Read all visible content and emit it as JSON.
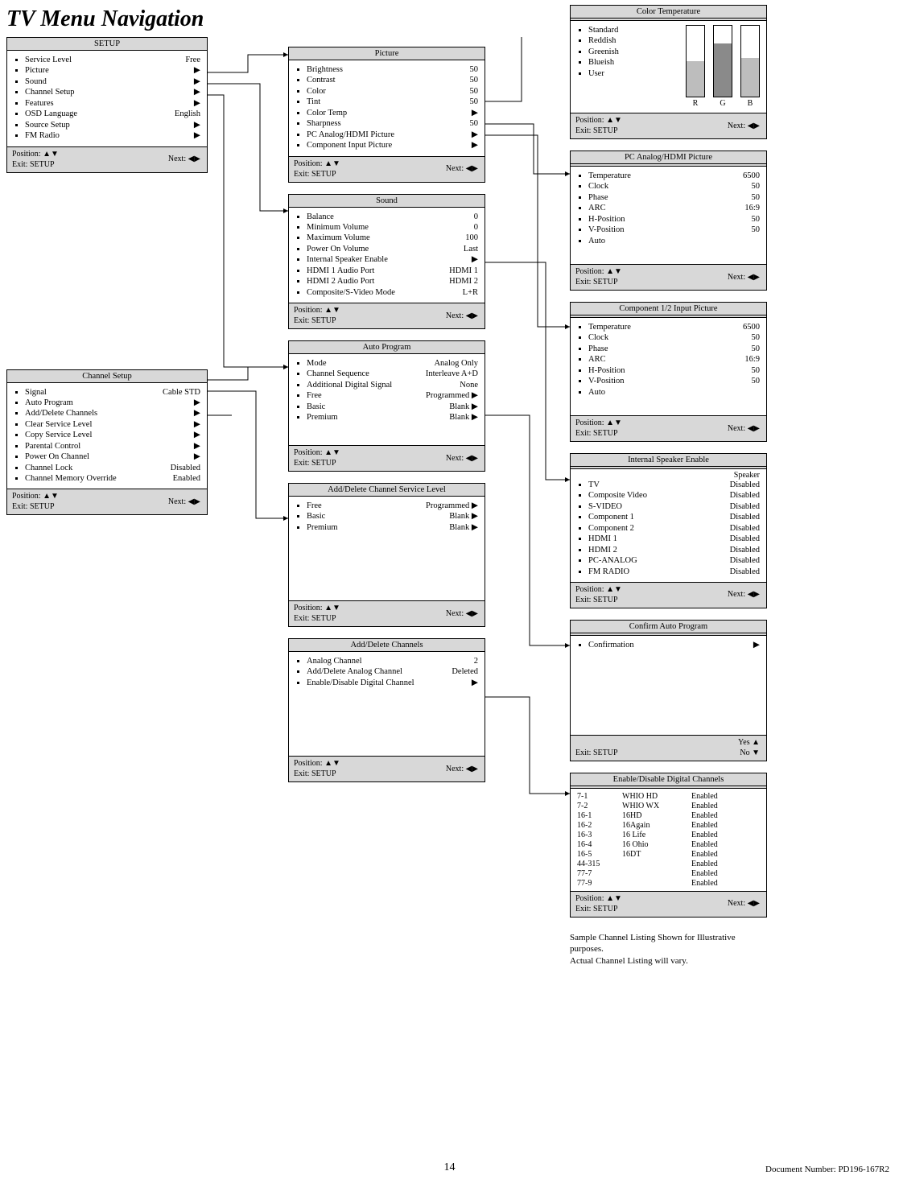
{
  "page_title": "TV Menu Navigation",
  "page_number": "14",
  "doc_number": "Document Number: PD196-167R2",
  "footer": {
    "position": "Position: ▲▼",
    "exit": "Exit: SETUP",
    "next": "Next: ◀▶"
  },
  "panels": {
    "setup": {
      "title": "SETUP",
      "items": [
        {
          "label": "Service Level",
          "value": "Free"
        },
        {
          "label": "Picture",
          "value": "▶"
        },
        {
          "label": "Sound",
          "value": "▶"
        },
        {
          "label": "Channel Setup",
          "value": "▶"
        },
        {
          "label": "Features",
          "value": "▶"
        },
        {
          "label": "OSD Language",
          "value": "English"
        },
        {
          "label": "Source Setup",
          "value": "▶"
        },
        {
          "label": "FM Radio",
          "value": "▶"
        }
      ]
    },
    "channel_setup": {
      "title": "Channel Setup",
      "items": [
        {
          "label": "Signal",
          "value": "Cable STD"
        },
        {
          "label": "Auto Program",
          "value": "▶"
        },
        {
          "label": "Add/Delete Channels",
          "value": "▶"
        },
        {
          "label": "Clear Service Level",
          "value": "▶"
        },
        {
          "label": "Copy Service Level",
          "value": "▶"
        },
        {
          "label": "Parental Control",
          "value": "▶"
        },
        {
          "label": "Power On Channel",
          "value": "▶"
        },
        {
          "label": "Channel Lock",
          "value": "Disabled"
        },
        {
          "label": "Channel Memory Override",
          "value": "Enabled"
        }
      ]
    },
    "picture": {
      "title": "Picture",
      "items": [
        {
          "label": "Brightness",
          "value": "50"
        },
        {
          "label": "Contrast",
          "value": "50"
        },
        {
          "label": "Color",
          "value": "50"
        },
        {
          "label": "Tint",
          "value": "50"
        },
        {
          "label": "Color Temp",
          "value": "▶"
        },
        {
          "label": "Sharpness",
          "value": "50"
        },
        {
          "label": "PC Analog/HDMI Picture",
          "value": "▶"
        },
        {
          "label": "Component Input Picture",
          "value": "▶"
        }
      ]
    },
    "sound": {
      "title": "Sound",
      "items": [
        {
          "label": "Balance",
          "value": "0"
        },
        {
          "label": "Minimum Volume",
          "value": "0"
        },
        {
          "label": "Maximum Volume",
          "value": "100"
        },
        {
          "label": "Power On Volume",
          "value": "Last"
        },
        {
          "label": "Internal Speaker Enable",
          "value": "▶"
        },
        {
          "label": "HDMI 1 Audio Port",
          "value": "HDMI 1"
        },
        {
          "label": "HDMI 2 Audio Port",
          "value": "HDMI 2"
        },
        {
          "label": "Composite/S-Video Mode",
          "value": "L+R"
        }
      ]
    },
    "auto_program": {
      "title": "Auto Program",
      "items": [
        {
          "label": "Mode",
          "value": "Analog Only"
        },
        {
          "label": "Channel Sequence",
          "value": "Interleave A+D"
        },
        {
          "label": "Additional Digital Signal",
          "value": "None"
        },
        {
          "label": "Free",
          "value": "Programmed ▶"
        },
        {
          "label": "Basic",
          "value": "Blank ▶"
        },
        {
          "label": "Premium",
          "value": "Blank ▶"
        }
      ]
    },
    "add_del_svc": {
      "title": "Add/Delete Channel Service Level",
      "items": [
        {
          "label": "Free",
          "value": "Programmed ▶"
        },
        {
          "label": "Basic",
          "value": "Blank ▶"
        },
        {
          "label": "Premium",
          "value": "Blank ▶"
        }
      ]
    },
    "add_del_ch": {
      "title": "Add/Delete Channels",
      "items": [
        {
          "label": "Analog Channel",
          "value": "2"
        },
        {
          "label": "Add/Delete Analog Channel",
          "value": "Deleted"
        },
        {
          "label": "Enable/Disable Digital Channel",
          "value": "▶"
        }
      ]
    },
    "color_temp": {
      "title": "Color Temperature",
      "items": [
        {
          "label": "Standard",
          "value": ""
        },
        {
          "label": "Reddish",
          "value": ""
        },
        {
          "label": "Greenish",
          "value": ""
        },
        {
          "label": "Blueish",
          "value": ""
        },
        {
          "label": "User",
          "value": ""
        }
      ]
    },
    "pc_analog": {
      "title": "PC Analog/HDMI Picture",
      "items": [
        {
          "label": "Temperature",
          "value": "6500"
        },
        {
          "label": "Clock",
          "value": "50"
        },
        {
          "label": "Phase",
          "value": "50"
        },
        {
          "label": "ARC",
          "value": "16:9"
        },
        {
          "label": "H-Position",
          "value": "50"
        },
        {
          "label": "V-Position",
          "value": "50"
        },
        {
          "label": "Auto",
          "value": ""
        }
      ]
    },
    "component": {
      "title": "Component 1/2 Input Picture",
      "items": [
        {
          "label": "Temperature",
          "value": "6500"
        },
        {
          "label": "Clock",
          "value": "50"
        },
        {
          "label": "Phase",
          "value": "50"
        },
        {
          "label": "ARC",
          "value": "16:9"
        },
        {
          "label": "H-Position",
          "value": "50"
        },
        {
          "label": "V-Position",
          "value": "50"
        },
        {
          "label": "Auto",
          "value": ""
        }
      ]
    },
    "int_speaker": {
      "title": "Internal Speaker Enable",
      "header": "Speaker",
      "items": [
        {
          "label": "TV",
          "value": "Disabled"
        },
        {
          "label": "Composite Video",
          "value": "Disabled"
        },
        {
          "label": "S-VIDEO",
          "value": "Disabled"
        },
        {
          "label": "Component 1",
          "value": "Disabled"
        },
        {
          "label": "Component 2",
          "value": "Disabled"
        },
        {
          "label": "HDMI 1",
          "value": "Disabled"
        },
        {
          "label": "HDMI 2",
          "value": "Disabled"
        },
        {
          "label": "PC-ANALOG",
          "value": "Disabled"
        },
        {
          "label": "FM RADIO",
          "value": "Disabled"
        }
      ]
    },
    "confirm": {
      "title": "Confirm Auto Program",
      "items": [
        {
          "label": "Confirmation",
          "value": "▶"
        }
      ],
      "yes": "Yes  ▲",
      "no": "No  ▼"
    },
    "digital": {
      "title": "Enable/Disable Digital Channels",
      "rows": [
        {
          "ch": "7-1",
          "name": "WHIO HD",
          "st": "Enabled"
        },
        {
          "ch": "7-2",
          "name": "WHIO WX",
          "st": "Enabled"
        },
        {
          "ch": "16-1",
          "name": "16HD",
          "st": "Enabled"
        },
        {
          "ch": "16-2",
          "name": "16Again",
          "st": "Enabled"
        },
        {
          "ch": "16-3",
          "name": "16 Life",
          "st": "Enabled"
        },
        {
          "ch": "16-4",
          "name": "16 Ohio",
          "st": "Enabled"
        },
        {
          "ch": "16-5",
          "name": "16DT",
          "st": "Enabled"
        },
        {
          "ch": "44-315",
          "name": "",
          "st": "Enabled"
        },
        {
          "ch": "77-7",
          "name": "",
          "st": "Enabled"
        },
        {
          "ch": "77-9",
          "name": "",
          "st": "Enabled"
        }
      ],
      "note1": "Sample Channel Listing Shown for Illustrative purposes.",
      "note2": "Actual Channel Listing will vary."
    }
  },
  "chart_data": {
    "type": "bar",
    "categories": [
      "R",
      "G",
      "B"
    ],
    "values": [
      50,
      75,
      55
    ],
    "title": "Color Temperature RGB",
    "ylim": [
      0,
      100
    ]
  }
}
